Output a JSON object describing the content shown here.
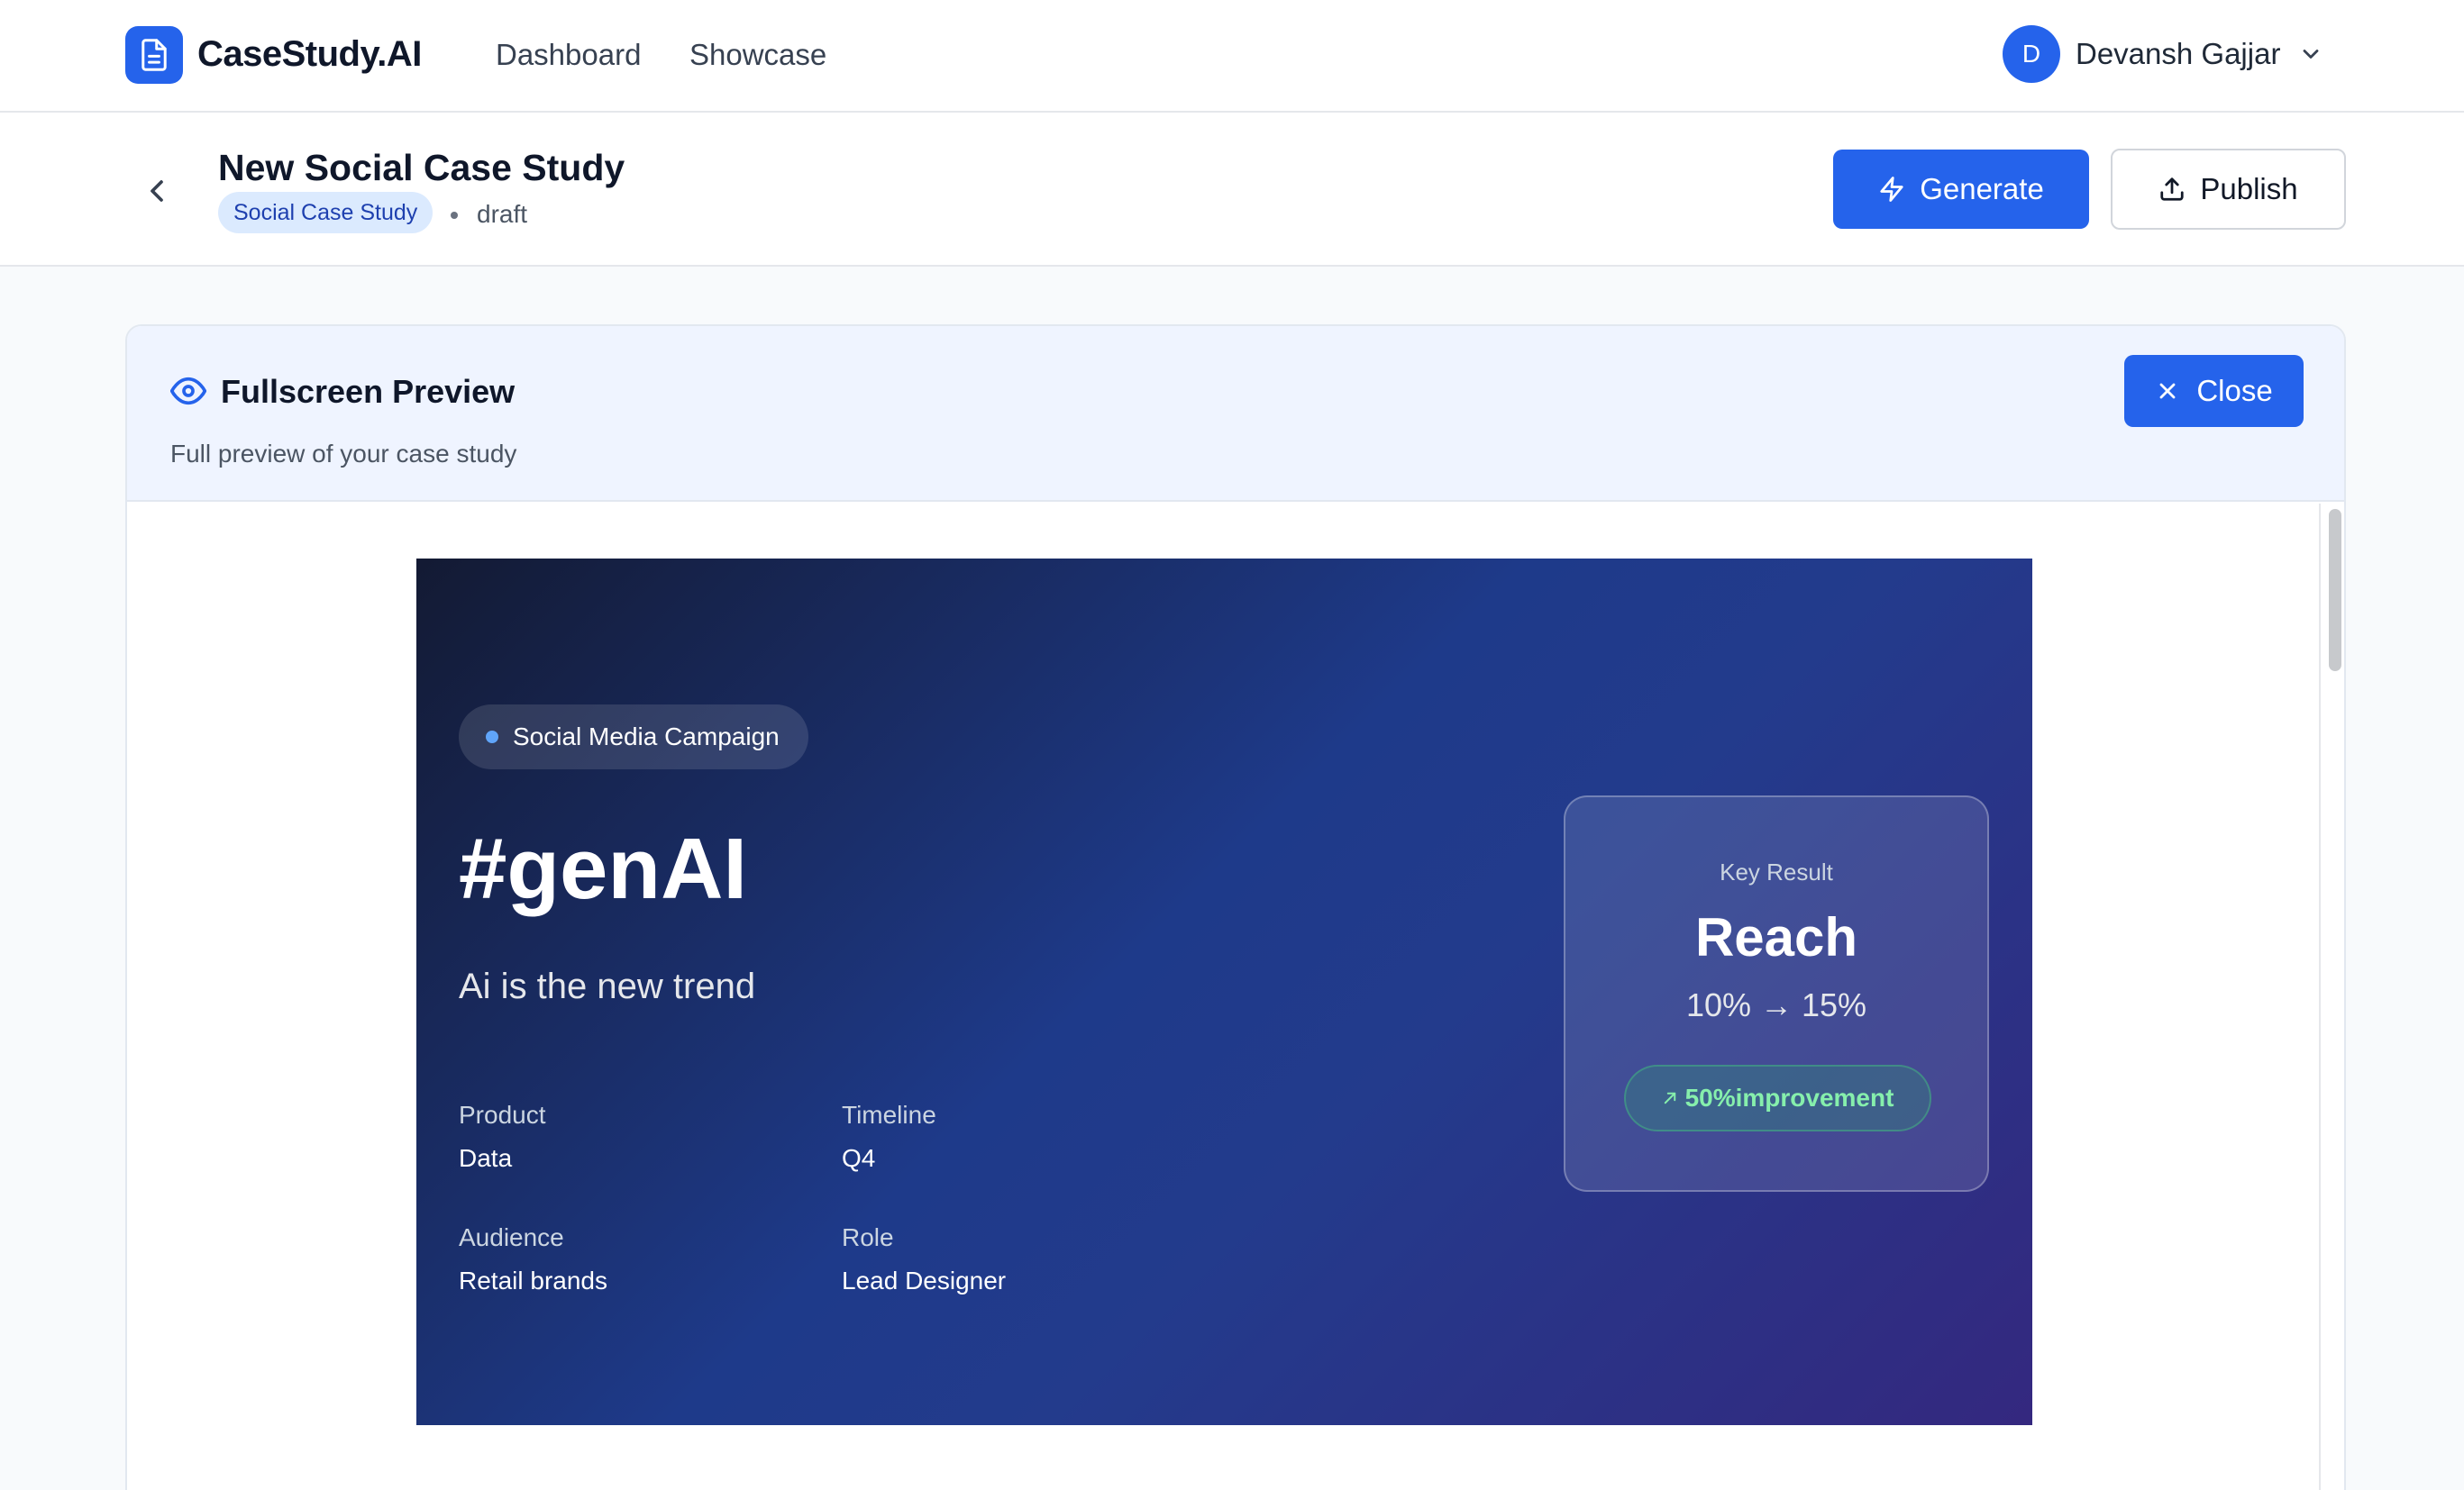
{
  "app": {
    "name": "CaseStudy.AI",
    "nav": [
      "Dashboard",
      "Showcase"
    ],
    "user": {
      "initial": "D",
      "name": "Devansh Gajjar"
    }
  },
  "subheader": {
    "title": "New Social Case Study",
    "type_badge": "Social Case Study",
    "status": "draft",
    "generate_label": "Generate",
    "publish_label": "Publish"
  },
  "preview": {
    "title": "Fullscreen Preview",
    "subtitle": "Full preview of your case study",
    "close_label": "Close"
  },
  "hero": {
    "pill": "Social Media Campaign",
    "title": "#genAI",
    "subtitle": "Ai is the new trend",
    "meta": {
      "product_label": "Product",
      "product_value": "Data",
      "timeline_label": "Timeline",
      "timeline_value": "Q4",
      "audience_label": "Audience",
      "audience_value": "Retail brands",
      "role_label": "Role",
      "role_value": "Lead Designer"
    },
    "key_result": {
      "label": "Key Result",
      "metric": "Reach",
      "change": "10% → 15%",
      "improvement": "50%improvement"
    }
  },
  "colors": {
    "accent": "#2563eb",
    "hero_start": "#131a33",
    "hero_end": "#34287f",
    "improvement": "#86efac"
  }
}
